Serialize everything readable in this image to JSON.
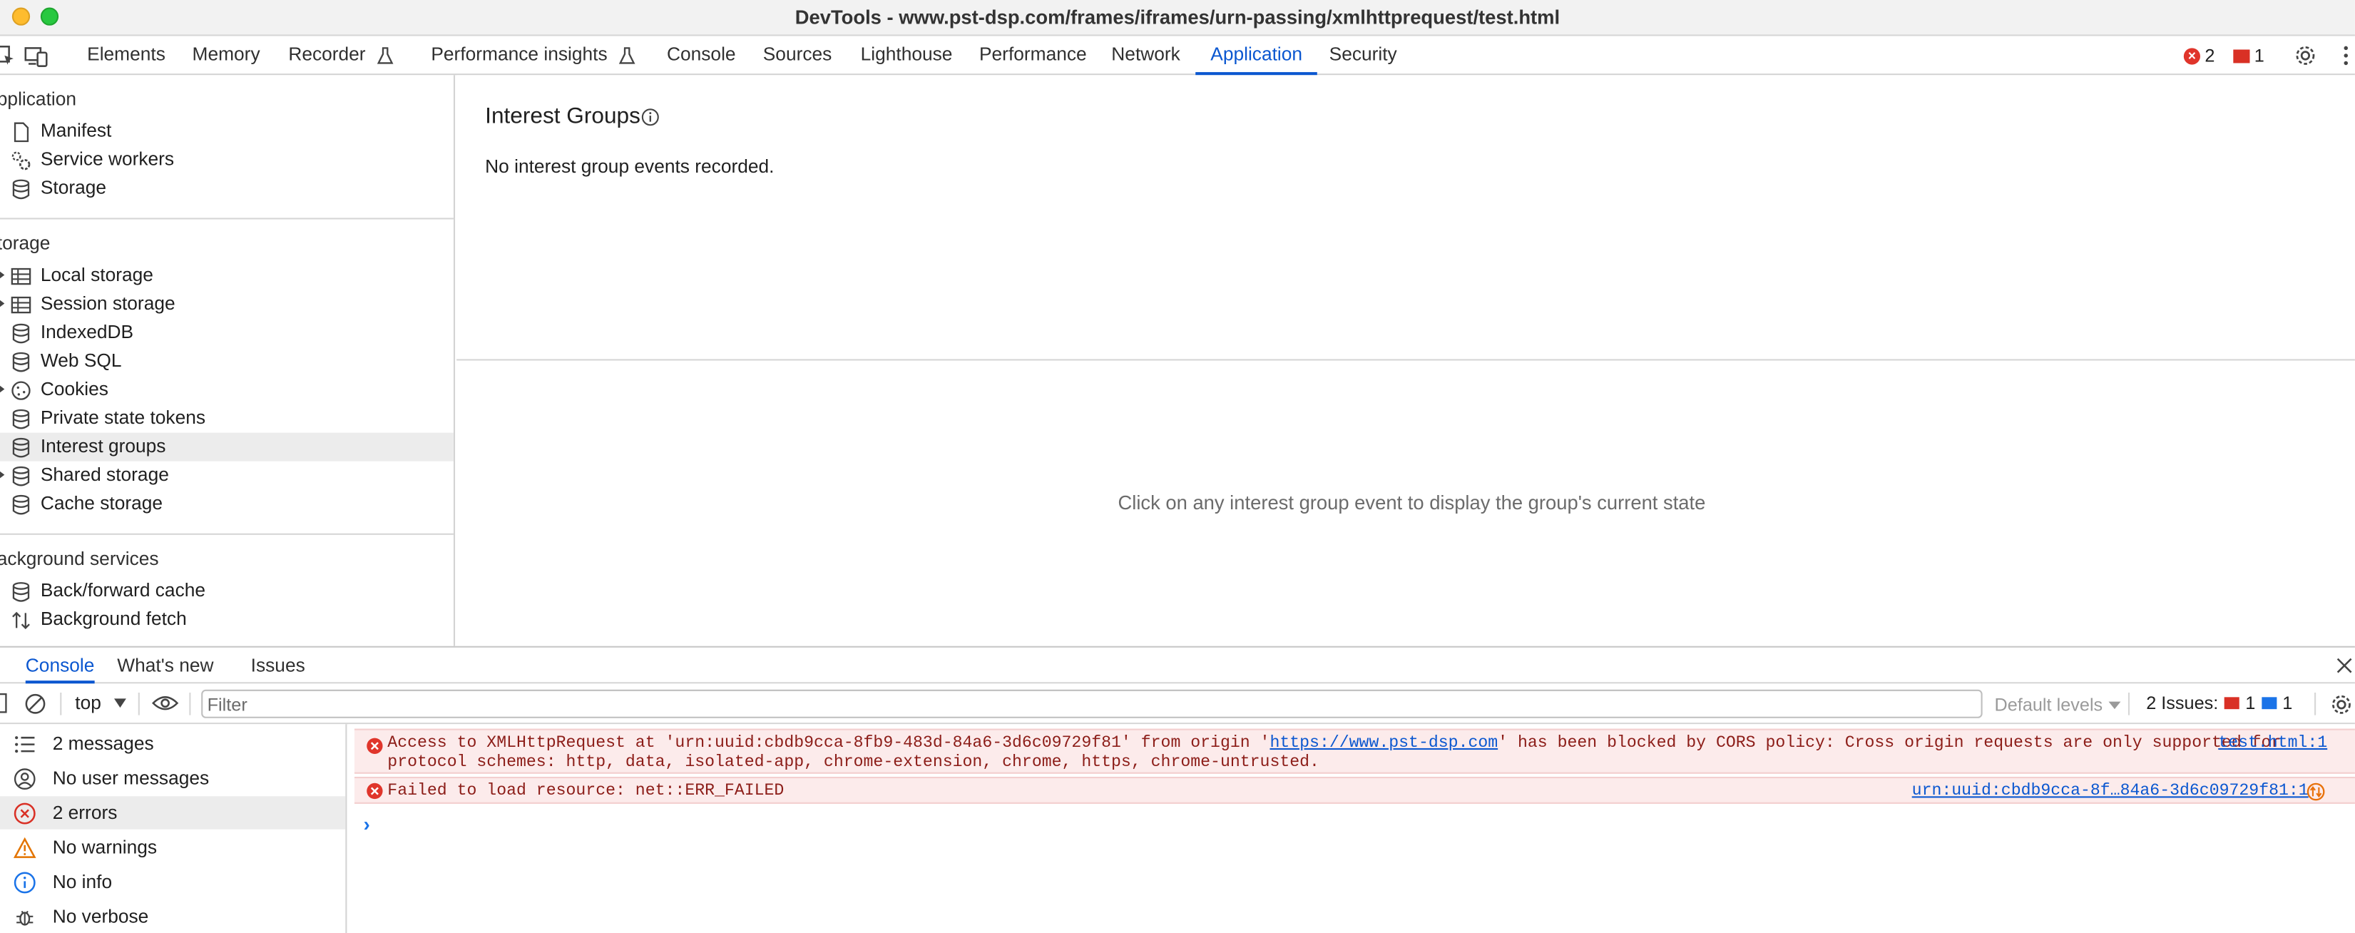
{
  "window": {
    "title": "DevTools - www.pst-dsp.com/frames/iframes/urn-passing/xmlhttprequest/test.html"
  },
  "toolbar": {
    "tabs": [
      {
        "label": "Elements"
      },
      {
        "label": "Memory"
      },
      {
        "label": "Recorder",
        "icon": "flask-icon"
      },
      {
        "label": "Performance insights",
        "icon": "flask-icon"
      },
      {
        "label": "Console"
      },
      {
        "label": "Sources"
      },
      {
        "label": "Lighthouse"
      },
      {
        "label": "Performance"
      },
      {
        "label": "Network"
      },
      {
        "label": "Application",
        "active": true
      },
      {
        "label": "Security"
      }
    ],
    "error_count": "2",
    "issue_count": "1"
  },
  "sidebar": {
    "sections": [
      {
        "title": "pplication",
        "items": [
          {
            "label": "Manifest",
            "icon": "file-icon"
          },
          {
            "label": "Service workers",
            "icon": "gears-icon"
          },
          {
            "label": "Storage",
            "icon": "database-icon"
          }
        ]
      },
      {
        "title": "torage",
        "items": [
          {
            "label": "Local storage",
            "icon": "table-icon",
            "expandable": true
          },
          {
            "label": "Session storage",
            "icon": "table-icon",
            "expandable": true
          },
          {
            "label": "IndexedDB",
            "icon": "database-icon"
          },
          {
            "label": "Web SQL",
            "icon": "database-icon"
          },
          {
            "label": "Cookies",
            "icon": "cookie-icon",
            "expandable": true
          },
          {
            "label": "Private state tokens",
            "icon": "database-icon"
          },
          {
            "label": "Interest groups",
            "icon": "database-icon",
            "selected": true
          },
          {
            "label": "Shared storage",
            "icon": "database-icon",
            "expandable": true
          },
          {
            "label": "Cache storage",
            "icon": "database-icon"
          }
        ]
      },
      {
        "title": "ackground services",
        "items": [
          {
            "label": "Back/forward cache",
            "icon": "database-icon"
          },
          {
            "label": "Background fetch",
            "icon": "arrows-updown-icon"
          }
        ]
      }
    ]
  },
  "main": {
    "title": "Interest Groups",
    "empty_message": "No interest group events recorded.",
    "hint": "Click on any interest group event to display the group's current state"
  },
  "drawer": {
    "tabs": [
      {
        "label": "Console",
        "active": true
      },
      {
        "label": "What's new"
      },
      {
        "label": "Issues"
      }
    ],
    "context": "top",
    "filter_placeholder": "Filter",
    "levels_label": "Default levels",
    "issues_label": "2 Issues:",
    "issues_error_count": "1",
    "issues_info_count": "1"
  },
  "console_sidebar": {
    "items": [
      {
        "label": "2 messages",
        "icon": "list-icon"
      },
      {
        "label": "No user messages",
        "icon": "user-circle-icon"
      },
      {
        "label": "2 errors",
        "icon": "error-circle-icon",
        "selected": true
      },
      {
        "label": "No warnings",
        "icon": "warning-icon"
      },
      {
        "label": "No info",
        "icon": "info-icon"
      },
      {
        "label": "No verbose",
        "icon": "bug-icon"
      }
    ]
  },
  "console_log": {
    "messages": [
      {
        "text_before": "Access to XMLHttpRequest at 'urn:uuid:cbdb9cca-8fb9-483d-84a6-3d6c09729f81' from origin '",
        "link": "https://www.pst-dsp.com",
        "text_after": "' has been blocked by CORS policy: Cross origin requests are only supported for",
        "text_line2": "protocol schemes: http, data, isolated-app, chrome-extension, chrome, https, chrome-untrusted.",
        "source": "test.html:1"
      },
      {
        "text": "Failed to load resource: net::ERR_FAILED",
        "source": "urn:uuid:cbdb9cca-8f…84a6-3d6c09729f81:1"
      }
    ],
    "prompt": "›"
  },
  "colors": {
    "accent": "#0b57d0",
    "error": "#e0352b",
    "error_bg": "#fcebeb"
  }
}
